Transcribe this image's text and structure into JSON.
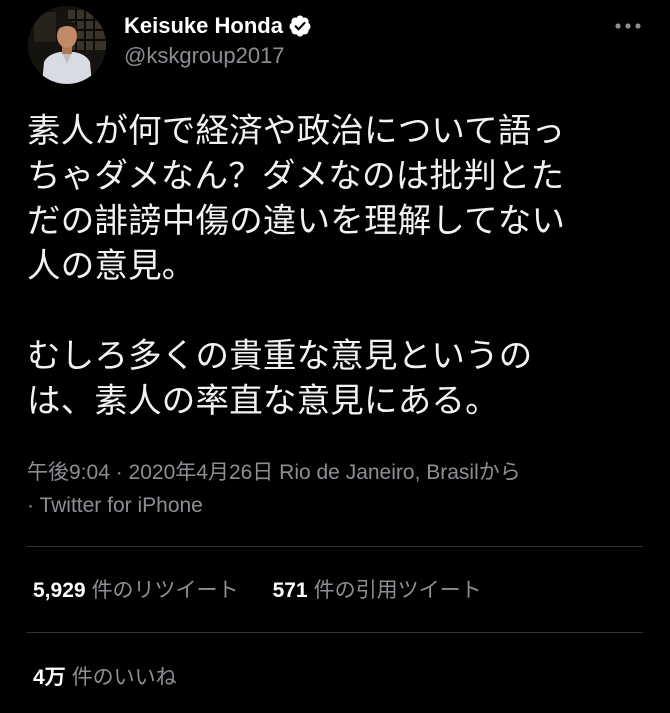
{
  "user": {
    "display_name": "Keisuke Honda",
    "handle": "@kskgroup2017",
    "verified": true,
    "avatar_icon": "profile-photo"
  },
  "tweet": {
    "paragraphs": [
      {
        "lines": [
          "素人が何で経済や政治について語っ",
          "ちゃダメなん？ダメなのは批判とた",
          "だの誹謗中傷の違いを理解してない",
          "人の意見。"
        ]
      },
      {
        "lines": [
          "むしろ多くの貴重な意見というの",
          "は、素人の率直な意見にある。"
        ]
      }
    ]
  },
  "meta": {
    "time": "午後9:04",
    "separator": " · ",
    "date": "2020年4月26日",
    "location": "Rio de Janeiro, Brasil",
    "location_suffix": "から",
    "source_prefix": "· ",
    "source": "Twitter for iPhone"
  },
  "stats": {
    "retweets": {
      "count": "5,929",
      "label": "件のリツイート"
    },
    "quotes": {
      "count": "571",
      "label": "件の引用ツイート"
    },
    "likes": {
      "count": "4万",
      "label": "件のいいね"
    }
  },
  "colors": {
    "background": "#000000",
    "text": "#ffffff",
    "secondary": "#8b8f94",
    "divider": "#2f3336",
    "verified_badge": "#ffffff"
  }
}
